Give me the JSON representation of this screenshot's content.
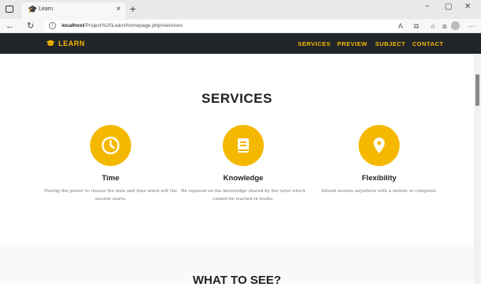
{
  "browser": {
    "tab_title": "Learn",
    "tab_close": "×",
    "new_tab": "+",
    "url_host": "localhost",
    "url_path": "/Project%20Learn/homepage.php#services",
    "win_minimize": "−",
    "win_restore": "▢",
    "win_close": "✕"
  },
  "nav": {
    "brand": "LEARN",
    "links": [
      "SERVICES",
      "PREVIEW",
      "SUBJECT",
      "CONTACT"
    ]
  },
  "services": {
    "title": "SERVICES",
    "items": [
      {
        "icon": "clock-icon",
        "title": "Time",
        "text": "Having the power to choose the date and time when will the session starts."
      },
      {
        "icon": "book-icon",
        "title": "Knowledge",
        "text": "Be exposed on the knowledge shared by the tutor which cannot be learned in books."
      },
      {
        "icon": "location-pin-icon",
        "title": "Flexibility",
        "text": "Attend session anywhere with a mobile or computer."
      }
    ]
  },
  "next_section": {
    "title": "WHAT TO SEE?"
  },
  "colors": {
    "accent": "#f5b800",
    "navbar": "#212529"
  }
}
